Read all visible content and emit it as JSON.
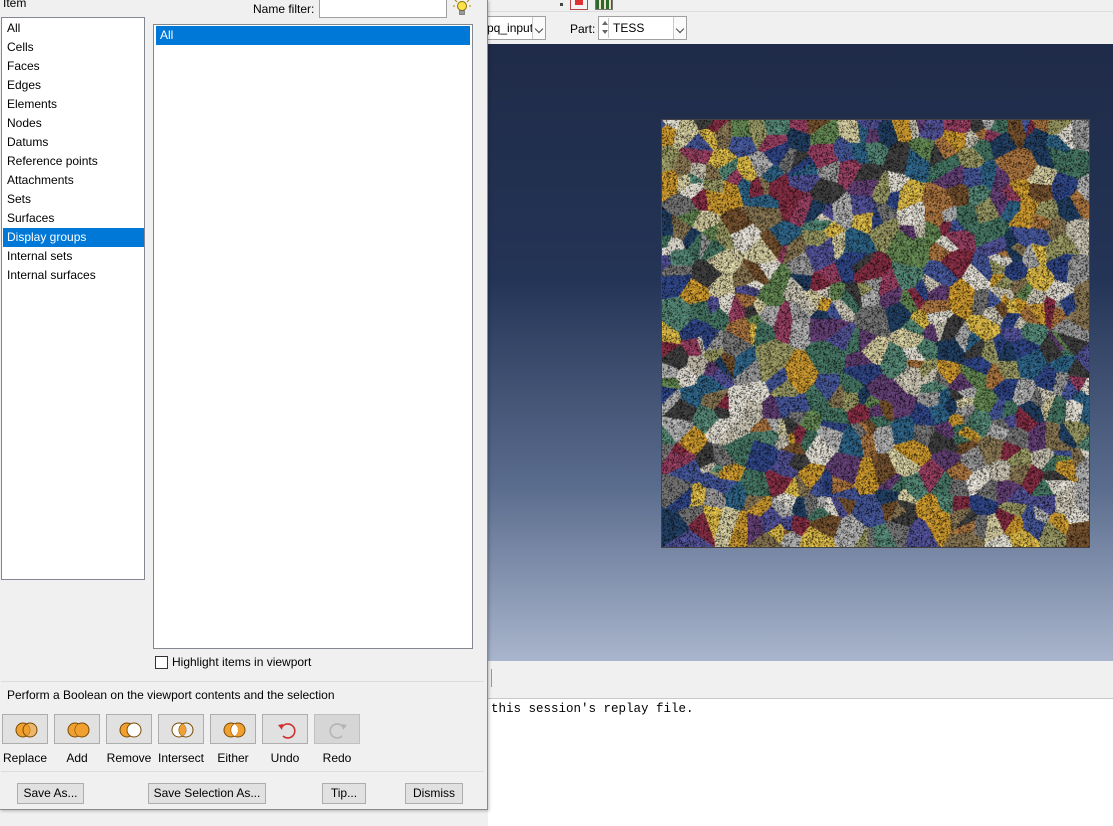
{
  "viewport_context": {
    "model_combo_value": "pq_input",
    "part_label": "Part:",
    "part_combo_value": "TESS"
  },
  "message_area": {
    "line": ": this session's replay file."
  },
  "dialog": {
    "item_label": "Item",
    "name_filter_label": "Name filter:",
    "name_filter_value": "",
    "item_list": [
      {
        "label": "All",
        "selected": false
      },
      {
        "label": "Cells",
        "selected": false
      },
      {
        "label": "Faces",
        "selected": false
      },
      {
        "label": "Edges",
        "selected": false
      },
      {
        "label": "Elements",
        "selected": false
      },
      {
        "label": "Nodes",
        "selected": false
      },
      {
        "label": "Datums",
        "selected": false
      },
      {
        "label": "Reference points",
        "selected": false
      },
      {
        "label": "Attachments",
        "selected": false
      },
      {
        "label": "Sets",
        "selected": false
      },
      {
        "label": "Surfaces",
        "selected": false
      },
      {
        "label": "Display groups",
        "selected": true
      },
      {
        "label": "Internal sets",
        "selected": false
      },
      {
        "label": "Internal surfaces",
        "selected": false
      }
    ],
    "group_list": [
      {
        "label": "All",
        "selected": true
      }
    ],
    "highlight_checkbox": {
      "label": "Highlight items in viewport",
      "checked": false
    },
    "boolean_heading": "Perform a Boolean on the viewport contents and the selection",
    "boolean_buttons": [
      {
        "label": "Replace",
        "icon": "venn-replace-icon",
        "enabled": true
      },
      {
        "label": "Add",
        "icon": "venn-add-icon",
        "enabled": true
      },
      {
        "label": "Remove",
        "icon": "venn-remove-icon",
        "enabled": true
      },
      {
        "label": "Intersect",
        "icon": "venn-intersect-icon",
        "enabled": true
      },
      {
        "label": "Either",
        "icon": "venn-either-icon",
        "enabled": true
      },
      {
        "label": "Undo",
        "icon": "undo-arrow-icon",
        "enabled": true
      },
      {
        "label": "Redo",
        "icon": "redo-arrow-icon",
        "enabled": false
      }
    ],
    "bottom_buttons": {
      "save_as": "Save As...",
      "save_selection_as": "Save Selection As...",
      "tip": "Tip...",
      "dismiss": "Dismiss"
    }
  },
  "colors": {
    "selection": "#0078d7",
    "viewport_top": "#1f2b48",
    "viewport_bottom": "#a9b5cc",
    "venn_orange": "#f0a030",
    "undo_red": "#d03030"
  }
}
